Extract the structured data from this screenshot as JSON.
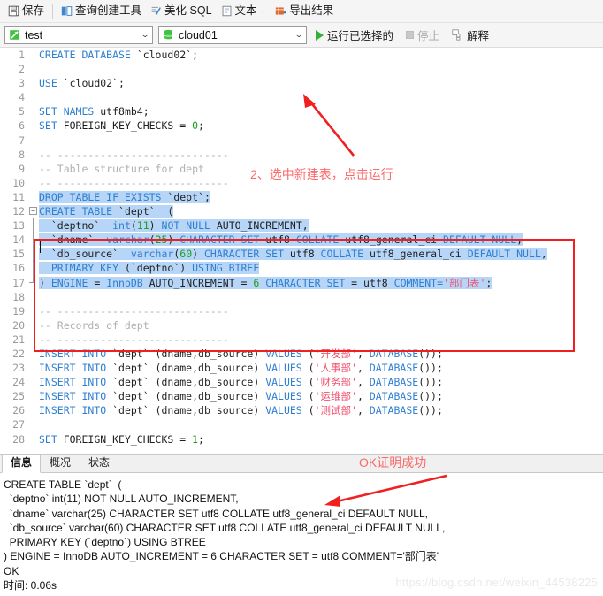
{
  "toolbar": {
    "items": [
      {
        "label": "保存",
        "icon": "save-icon",
        "name": "save-button"
      },
      {
        "label": "查询创建工具",
        "icon": "query-builder-icon",
        "name": "query-builder-button"
      },
      {
        "label": "美化 SQL",
        "icon": "beautify-icon",
        "name": "beautify-sql-button"
      },
      {
        "label": "文本",
        "icon": "text-icon",
        "name": "text-button"
      },
      {
        "label": "导出结果",
        "icon": "export-icon",
        "name": "export-result-button"
      }
    ],
    "text_dot": "·"
  },
  "runbar": {
    "connection": {
      "value": "test",
      "icon": "connection-icon"
    },
    "database": {
      "value": "cloud01",
      "icon": "database-icon"
    },
    "run_selected_label": "运行已选择的",
    "stop_label": "停止",
    "explain_label": "解释",
    "chevron": "⌄"
  },
  "annotations": {
    "step2": "2、选中新建表，点击运行",
    "ok_note": "OK证明成功"
  },
  "editor": {
    "lines": [
      {
        "n": 1,
        "tokens": [
          {
            "t": "CREATE DATABASE ",
            "c": "kw"
          },
          {
            "t": "`cloud02`;",
            "c": "plain"
          }
        ]
      },
      {
        "n": 2,
        "tokens": []
      },
      {
        "n": 3,
        "tokens": [
          {
            "t": "USE ",
            "c": "kw"
          },
          {
            "t": "`cloud02`;",
            "c": "plain"
          }
        ]
      },
      {
        "n": 4,
        "tokens": []
      },
      {
        "n": 5,
        "tokens": [
          {
            "t": "SET NAMES ",
            "c": "kw"
          },
          {
            "t": "utf8mb4;",
            "c": "plain"
          }
        ]
      },
      {
        "n": 6,
        "tokens": [
          {
            "t": "SET ",
            "c": "kw"
          },
          {
            "t": "FOREIGN_KEY_CHECKS = ",
            "c": "plain"
          },
          {
            "t": "0",
            "c": "num"
          },
          {
            "t": ";",
            "c": "plain"
          }
        ]
      },
      {
        "n": 7,
        "tokens": []
      },
      {
        "n": 8,
        "tokens": [
          {
            "t": "-- ----------------------------",
            "c": "cmt"
          }
        ]
      },
      {
        "n": 9,
        "tokens": [
          {
            "t": "-- Table structure for dept",
            "c": "cmt"
          }
        ]
      },
      {
        "n": 10,
        "tokens": [
          {
            "t": "-- ----------------------------",
            "c": "cmt"
          }
        ]
      },
      {
        "n": 11,
        "sel": true,
        "tokens": [
          {
            "t": "DROP TABLE IF EXISTS ",
            "c": "kw"
          },
          {
            "t": "`dept`;",
            "c": "plain"
          }
        ]
      },
      {
        "n": 12,
        "sel": true,
        "fold": "minus",
        "tokens": [
          {
            "t": "CREATE TABLE ",
            "c": "kw"
          },
          {
            "t": "`dept`  (",
            "c": "plain"
          }
        ]
      },
      {
        "n": 13,
        "sel": true,
        "tokens": [
          {
            "t": "  `deptno`  ",
            "c": "plain"
          },
          {
            "t": "int",
            "c": "kw"
          },
          {
            "t": "(",
            "c": "plain"
          },
          {
            "t": "11",
            "c": "num"
          },
          {
            "t": ") ",
            "c": "plain"
          },
          {
            "t": "NOT NULL ",
            "c": "kw"
          },
          {
            "t": "AUTO_INCREMENT,",
            "c": "plain"
          }
        ]
      },
      {
        "n": 14,
        "sel": true,
        "tokens": [
          {
            "t": "  `dname`  ",
            "c": "plain"
          },
          {
            "t": "varchar",
            "c": "kw"
          },
          {
            "t": "(",
            "c": "plain"
          },
          {
            "t": "25",
            "c": "num"
          },
          {
            "t": ") ",
            "c": "plain"
          },
          {
            "t": "CHARACTER SET ",
            "c": "kw"
          },
          {
            "t": "utf8 ",
            "c": "plain"
          },
          {
            "t": "COLLATE ",
            "c": "kw"
          },
          {
            "t": "utf8_general_ci ",
            "c": "plain"
          },
          {
            "t": "DEFAULT NULL",
            "c": "kw"
          },
          {
            "t": ",",
            "c": "plain"
          }
        ]
      },
      {
        "n": 15,
        "sel": true,
        "tokens": [
          {
            "t": "  `db_source`  ",
            "c": "plain"
          },
          {
            "t": "varchar",
            "c": "kw"
          },
          {
            "t": "(",
            "c": "plain"
          },
          {
            "t": "60",
            "c": "num"
          },
          {
            "t": ") ",
            "c": "plain"
          },
          {
            "t": "CHARACTER SET ",
            "c": "kw"
          },
          {
            "t": "utf8 ",
            "c": "plain"
          },
          {
            "t": "COLLATE ",
            "c": "kw"
          },
          {
            "t": "utf8_general_ci ",
            "c": "plain"
          },
          {
            "t": "DEFAULT NULL",
            "c": "kw"
          },
          {
            "t": ",",
            "c": "plain"
          }
        ]
      },
      {
        "n": 16,
        "sel": true,
        "tokens": [
          {
            "t": "  ",
            "c": "plain"
          },
          {
            "t": "PRIMARY KEY ",
            "c": "kw"
          },
          {
            "t": "(`deptno`) ",
            "c": "plain"
          },
          {
            "t": "USING BTREE",
            "c": "kw"
          }
        ]
      },
      {
        "n": 17,
        "sel": true,
        "fold": "end",
        "tokens": [
          {
            "t": ") ",
            "c": "plain"
          },
          {
            "t": "ENGINE ",
            "c": "kw"
          },
          {
            "t": "= ",
            "c": "plain"
          },
          {
            "t": "InnoDB ",
            "c": "kw"
          },
          {
            "t": "AUTO_INCREMENT = ",
            "c": "plain"
          },
          {
            "t": "6",
            "c": "num"
          },
          {
            "t": " ",
            "c": "plain"
          },
          {
            "t": "CHARACTER SET ",
            "c": "kw"
          },
          {
            "t": "= utf8 ",
            "c": "plain"
          },
          {
            "t": "COMMENT=",
            "c": "kw"
          },
          {
            "t": "'部门表'",
            "c": "str"
          },
          {
            "t": ";",
            "c": "plain"
          }
        ]
      },
      {
        "n": 18,
        "tokens": []
      },
      {
        "n": 19,
        "tokens": [
          {
            "t": "-- ----------------------------",
            "c": "cmt"
          }
        ]
      },
      {
        "n": 20,
        "tokens": [
          {
            "t": "-- Records of dept",
            "c": "cmt"
          }
        ]
      },
      {
        "n": 21,
        "tokens": [
          {
            "t": "-- ----------------------------",
            "c": "cmt"
          }
        ]
      },
      {
        "n": 22,
        "tokens": [
          {
            "t": "INSERT INTO ",
            "c": "kw"
          },
          {
            "t": "`dept` (dname,db_source) ",
            "c": "plain"
          },
          {
            "t": "VALUES ",
            "c": "kw"
          },
          {
            "t": "(",
            "c": "plain"
          },
          {
            "t": "'开发部'",
            "c": "str"
          },
          {
            "t": ", ",
            "c": "plain"
          },
          {
            "t": "DATABASE",
            "c": "kw"
          },
          {
            "t": "());",
            "c": "plain"
          }
        ]
      },
      {
        "n": 23,
        "tokens": [
          {
            "t": "INSERT INTO ",
            "c": "kw"
          },
          {
            "t": "`dept` (dname,db_source) ",
            "c": "plain"
          },
          {
            "t": "VALUES ",
            "c": "kw"
          },
          {
            "t": "(",
            "c": "plain"
          },
          {
            "t": "'人事部'",
            "c": "str"
          },
          {
            "t": ", ",
            "c": "plain"
          },
          {
            "t": "DATABASE",
            "c": "kw"
          },
          {
            "t": "());",
            "c": "plain"
          }
        ]
      },
      {
        "n": 24,
        "tokens": [
          {
            "t": "INSERT INTO ",
            "c": "kw"
          },
          {
            "t": "`dept` (dname,db_source) ",
            "c": "plain"
          },
          {
            "t": "VALUES ",
            "c": "kw"
          },
          {
            "t": "(",
            "c": "plain"
          },
          {
            "t": "'财务部'",
            "c": "str"
          },
          {
            "t": ", ",
            "c": "plain"
          },
          {
            "t": "DATABASE",
            "c": "kw"
          },
          {
            "t": "());",
            "c": "plain"
          }
        ]
      },
      {
        "n": 25,
        "tokens": [
          {
            "t": "INSERT INTO ",
            "c": "kw"
          },
          {
            "t": "`dept` (dname,db_source) ",
            "c": "plain"
          },
          {
            "t": "VALUES ",
            "c": "kw"
          },
          {
            "t": "(",
            "c": "plain"
          },
          {
            "t": "'运维部'",
            "c": "str"
          },
          {
            "t": ", ",
            "c": "plain"
          },
          {
            "t": "DATABASE",
            "c": "kw"
          },
          {
            "t": "());",
            "c": "plain"
          }
        ]
      },
      {
        "n": 26,
        "tokens": [
          {
            "t": "INSERT INTO ",
            "c": "kw"
          },
          {
            "t": "`dept` (dname,db_source) ",
            "c": "plain"
          },
          {
            "t": "VALUES ",
            "c": "kw"
          },
          {
            "t": "(",
            "c": "plain"
          },
          {
            "t": "'测试部'",
            "c": "str"
          },
          {
            "t": ", ",
            "c": "plain"
          },
          {
            "t": "DATABASE",
            "c": "kw"
          },
          {
            "t": "());",
            "c": "plain"
          }
        ]
      },
      {
        "n": 27,
        "tokens": []
      },
      {
        "n": 28,
        "tokens": [
          {
            "t": "SET ",
            "c": "kw"
          },
          {
            "t": "FOREIGN_KEY_CHECKS = ",
            "c": "plain"
          },
          {
            "t": "1",
            "c": "num"
          },
          {
            "t": ";",
            "c": "plain"
          }
        ]
      }
    ]
  },
  "result": {
    "tabs": [
      {
        "label": "信息",
        "active": true,
        "name": "tab-info"
      },
      {
        "label": "概况",
        "active": false,
        "name": "tab-profile"
      },
      {
        "label": "状态",
        "active": false,
        "name": "tab-status"
      }
    ],
    "log": "CREATE TABLE `dept`  (\n  `deptno` int(11) NOT NULL AUTO_INCREMENT,\n  `dname` varchar(25) CHARACTER SET utf8 COLLATE utf8_general_ci DEFAULT NULL,\n  `db_source` varchar(60) CHARACTER SET utf8 COLLATE utf8_general_ci DEFAULT NULL,\n  PRIMARY KEY (`deptno`) USING BTREE\n) ENGINE = InnoDB AUTO_INCREMENT = 6 CHARACTER SET = utf8 COMMENT='部门表'\nOK\n时间: 0.06s"
  },
  "watermark": "https://blog.csdn.net/weixin_44538225",
  "colors": {
    "keyword": "#2f7fd1",
    "number": "#1aa01a",
    "string": "#f0506e",
    "comment": "#b0b0b0",
    "selection": "#b7d6f7",
    "annotation_red": "#fb6a6a",
    "box_red": "#f02020",
    "run_green": "#35b035"
  }
}
